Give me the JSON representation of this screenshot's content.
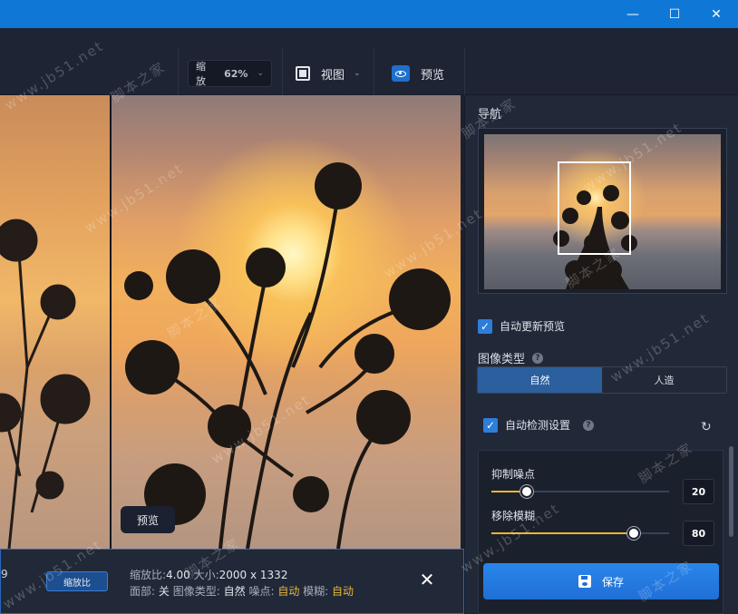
{
  "window": {
    "minimize_glyph": "—",
    "maximize_glyph": "☐",
    "close_glyph": "✕"
  },
  "toolbar": {
    "zoom_label": "缩放",
    "zoom_value": "62%",
    "view_label": "视图",
    "preview_label": "预览"
  },
  "canvas": {
    "preview_tag": "预览"
  },
  "infobar": {
    "left_number": "9",
    "ratio_button": "缩放比",
    "ratio_label": "缩放比:",
    "ratio_value": "4.00",
    "size_label": "大小:",
    "size_value": "2000 x 1332",
    "face_label": "面部:",
    "face_value": "关",
    "type_label": "图像类型:",
    "type_value": "自然",
    "noise_label": "噪点:",
    "noise_value": "自动",
    "blur_label": "模糊:",
    "blur_value": "自动"
  },
  "panel": {
    "nav_title": "导航",
    "auto_update_label": "自动更新预览",
    "image_type_title": "图像类型",
    "type_natural": "自然",
    "type_artificial": "人造",
    "auto_detect_label": "自动检测设置",
    "sliders": [
      {
        "label": "抑制噪点",
        "value": 20,
        "display": "20"
      },
      {
        "label": "移除模糊",
        "value": 80,
        "display": "80"
      }
    ],
    "save_label": "保存"
  },
  "watermarks": [
    "www.jb51.net",
    "脚本之家"
  ],
  "colors": {
    "titlebar": "#0f78d7",
    "accent": "#2d7ed9",
    "slider_fill": "#f0b62a",
    "auto_value": "#e5b73a"
  }
}
